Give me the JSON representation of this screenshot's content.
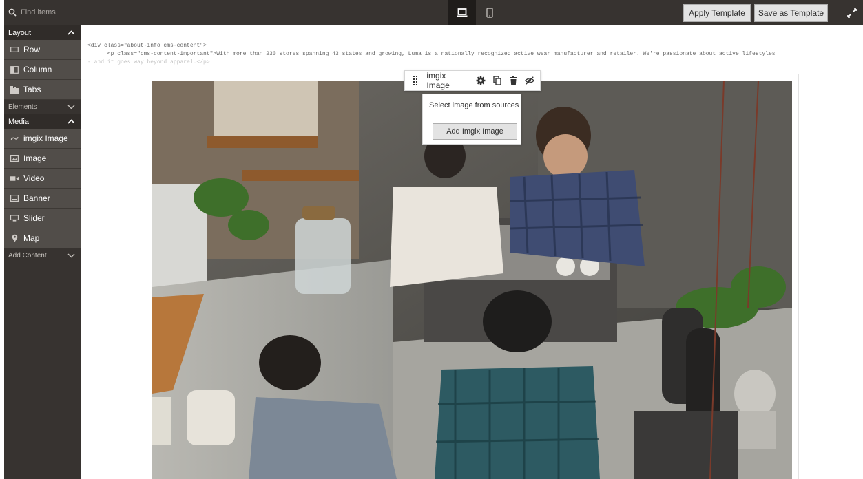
{
  "search": {
    "placeholder": "Find items"
  },
  "header": {
    "devices": [
      {
        "name": "desktop",
        "active": true
      },
      {
        "name": "mobile",
        "active": false
      }
    ],
    "apply_template": "Apply Template",
    "save_template": "Save as Template"
  },
  "panel": {
    "layout": {
      "label": "Layout",
      "items": [
        "Row",
        "Column",
        "Tabs"
      ]
    },
    "elements": {
      "label": "Elements"
    },
    "media": {
      "label": "Media",
      "items": [
        "imgix Image",
        "Image",
        "Video",
        "Banner",
        "Slider",
        "Map"
      ]
    },
    "add_content": {
      "label": "Add Content"
    }
  },
  "stage": {
    "code_line1": "<div class=\"about-info cms-content\">",
    "code_line2": "      <p class=\"cms-content-important\">With more than 230 stores spanning 43 states and growing, Luma is a nationally recognized active wear manufacturer and retailer. We're passionate about active lifestyles",
    "code_line3": "- and it goes way beyond apparel.</p>"
  },
  "toolbar": {
    "label": "imgix Image"
  },
  "popover": {
    "title": "Select image from sources",
    "button": "Add Imgix Image"
  },
  "colors": {
    "chrome": "#373330",
    "panel_item": "#514d49",
    "button_bg": "#e3e3e3"
  }
}
